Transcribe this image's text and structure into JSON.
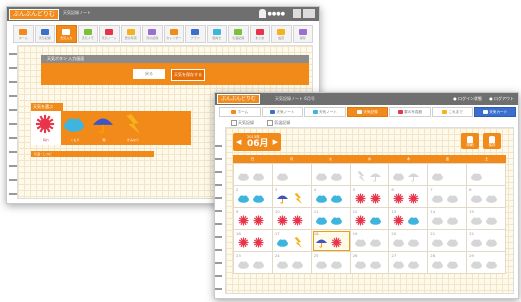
{
  "back_window": {
    "logo": "ぶんぶんどりむ",
    "subtitle": "天気記録ノート",
    "user_name": "●●●●",
    "nav": [
      {
        "label": "ホーム",
        "active": false
      },
      {
        "label": "天気記録",
        "active": false
      },
      {
        "label": "天気入力",
        "active": true
      },
      {
        "label": "天気メモ",
        "active": false
      },
      {
        "label": "天気ノート",
        "active": false
      },
      {
        "label": "雲の写真",
        "active": false
      },
      {
        "label": "月の記録",
        "active": false
      },
      {
        "label": "カレンダー",
        "active": false
      },
      {
        "label": "グラフ",
        "active": false
      },
      {
        "label": "風向き",
        "active": false
      },
      {
        "label": "気温記録",
        "active": false
      },
      {
        "label": "まとめ",
        "active": false
      },
      {
        "label": "設定",
        "active": false
      },
      {
        "label": "保存",
        "active": false
      }
    ],
    "dialog_title": "天気ボタン 入力画面",
    "btn_cancel": "戻る",
    "btn_save": "天気を保存する",
    "weather_label": "天気を選ぶ",
    "weather_options": [
      {
        "icon": "sun-icon",
        "label": "晴れ"
      },
      {
        "icon": "cloud-icon",
        "label": "くもり"
      },
      {
        "icon": "umbrella-icon",
        "label": "雨"
      },
      {
        "icon": "thunder-icon",
        "label": "かみなり"
      }
    ],
    "strip_label": "気温・しつど"
  },
  "front_window": {
    "logo": "ぶんぶんどりむ",
    "subtitle": "天気記録ノート 6月号",
    "header_right": [
      "● ログイン状態",
      "● ログアウト"
    ],
    "nav": [
      {
        "label": "ホーム",
        "style": "plain"
      },
      {
        "label": "天気ノート",
        "style": "plain"
      },
      {
        "label": "天気ノート",
        "style": "plain"
      },
      {
        "label": "天気記録",
        "style": "active"
      },
      {
        "label": "雲の写真館",
        "style": "plain"
      },
      {
        "label": "これまで",
        "style": "plain"
      },
      {
        "label": "天気カード",
        "style": "blue"
      }
    ],
    "checks": [
      "天気記録",
      "気温記録"
    ],
    "year_label": "2013年",
    "month_label": "06月",
    "right_buttons": [
      "印刷",
      "保存"
    ],
    "weekdays": [
      "日",
      "月",
      "火",
      "水",
      "木",
      "金",
      "土"
    ],
    "calendar_rows": [
      [
        {
          "n": "",
          "w": [
            "cloud-faded",
            "cloud-faded"
          ]
        },
        {
          "n": "",
          "w": [
            "cloud-faded"
          ]
        },
        {
          "n": "",
          "w": [
            "cloud-faded",
            "cloud-faded"
          ]
        },
        {
          "n": "",
          "w": [
            "thunder-faded",
            "umbrella-faded"
          ]
        },
        {
          "n": "",
          "w": [
            "cloud-faded",
            "umbrella-faded"
          ]
        },
        {
          "n": "",
          "w": [
            "cloud-faded"
          ]
        },
        {
          "n": "",
          "w": [
            "cloud-faded"
          ]
        }
      ],
      [
        {
          "n": "2",
          "w": [
            "cloud",
            "cloud"
          ]
        },
        {
          "n": "3",
          "w": [
            "umbrella",
            "thunder"
          ]
        },
        {
          "n": "4",
          "w": [
            "cloud",
            "cloud"
          ]
        },
        {
          "n": "5",
          "w": [
            "sun",
            "sun"
          ]
        },
        {
          "n": "6",
          "w": [
            "sun",
            "sun"
          ]
        },
        {
          "n": "7",
          "w": [
            "cloud-faded",
            "cloud-faded"
          ]
        },
        {
          "n": "8",
          "w": [
            "cloud-faded",
            "cloud-faded"
          ]
        }
      ],
      [
        {
          "n": "9",
          "w": [
            "sun",
            "sun"
          ]
        },
        {
          "n": "10",
          "w": [
            "sun",
            "sun"
          ]
        },
        {
          "n": "11",
          "w": [
            "cloud",
            "cloud"
          ]
        },
        {
          "n": "12",
          "w": [
            "sun",
            "cloud"
          ]
        },
        {
          "n": "13",
          "w": [
            "sun",
            "cloud"
          ]
        },
        {
          "n": "14",
          "w": [
            "cloud-faded",
            "cloud-faded"
          ]
        },
        {
          "n": "15",
          "w": [
            "cloud-faded",
            "cloud-faded"
          ]
        }
      ],
      [
        {
          "n": "16",
          "w": [
            "sun",
            "sun"
          ]
        },
        {
          "n": "17",
          "w": [
            "cloud",
            "thunder"
          ]
        },
        {
          "n": "18",
          "w": [
            "umbrella",
            "sun"
          ]
        },
        {
          "n": "19",
          "w": [
            "cloud-faded",
            "cloud-faded"
          ]
        },
        {
          "n": "20",
          "w": [
            "cloud-faded",
            "cloud-faded"
          ]
        },
        {
          "n": "21",
          "w": [
            "cloud-faded",
            "cloud-faded"
          ]
        },
        {
          "n": "22",
          "w": [
            "cloud-faded",
            "cloud-faded"
          ]
        }
      ],
      [
        {
          "n": "23",
          "w": [
            "cloud-faded",
            "cloud-faded"
          ]
        },
        {
          "n": "24",
          "w": [
            "cloud-faded",
            "cloud-faded"
          ]
        },
        {
          "n": "25",
          "w": [
            "cloud-faded",
            "cloud-faded"
          ]
        },
        {
          "n": "26",
          "w": [
            "cloud-faded",
            "cloud-faded"
          ]
        },
        {
          "n": "27",
          "w": [
            "cloud-faded",
            "cloud-faded"
          ]
        },
        {
          "n": "28",
          "w": [
            "cloud-faded",
            "cloud-faded"
          ]
        },
        {
          "n": "29",
          "w": [
            "cloud-faded",
            "cloud-faded"
          ]
        }
      ]
    ],
    "today_cell": "18"
  },
  "colors": {
    "accent": "#f28a1a",
    "titlebar": "#6f6f6f",
    "blue": "#3a6fcf",
    "sun": "#e8344a",
    "cloud": "#3fb5dd",
    "umbrella": "#3b55c4",
    "thunder": "#f5b21e",
    "faded": "#d6d6d6"
  }
}
